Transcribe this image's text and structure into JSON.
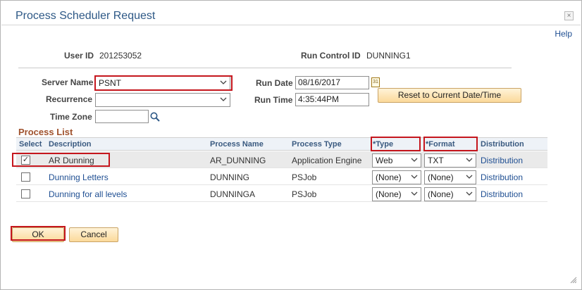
{
  "dialog": {
    "title": "Process Scheduler Request",
    "close_label": "×",
    "help_label": "Help"
  },
  "header": {
    "user_id_label": "User ID",
    "user_id_value": "201253052",
    "run_control_label": "Run Control ID",
    "run_control_value": "DUNNING1"
  },
  "form": {
    "server_name_label": "Server Name",
    "server_name_value": "PSNT",
    "recurrence_label": "Recurrence",
    "recurrence_value": "",
    "time_zone_label": "Time Zone",
    "time_zone_value": "",
    "run_date_label": "Run Date",
    "run_date_value": "08/16/2017",
    "run_time_label": "Run Time",
    "run_time_value": "4:35:44PM",
    "reset_button_label": "Reset to Current Date/Time",
    "calendar_icon_text": "31"
  },
  "process_list": {
    "title": "Process List",
    "columns": [
      "Select",
      "Description",
      "Process Name",
      "Process Type",
      "*Type",
      "*Format",
      "Distribution"
    ],
    "rows": [
      {
        "selected": true,
        "description": "AR Dunning",
        "process_name": "AR_DUNNING",
        "process_type": "Application Engine",
        "type": "Web",
        "format": "TXT",
        "distribution": "Distribution",
        "check": "✓"
      },
      {
        "selected": false,
        "description": "Dunning Letters",
        "process_name": "DUNNING",
        "process_type": "PSJob",
        "type": "(None)",
        "format": "(None)",
        "distribution": "Distribution",
        "check": ""
      },
      {
        "selected": false,
        "description": "Dunning for all levels",
        "process_name": "DUNNINGA",
        "process_type": "PSJob",
        "type": "(None)",
        "format": "(None)",
        "distribution": "Distribution",
        "check": ""
      }
    ]
  },
  "footer": {
    "ok_label": "OK",
    "cancel_label": "Cancel"
  },
  "colors": {
    "highlight_red": "#c5161d",
    "title_blue": "#2d5886",
    "link_blue": "#1e4e92",
    "section_brown": "#a0522d"
  },
  "icons": [
    "close-icon",
    "calendar-icon",
    "search-icon",
    "chevron-down-icon",
    "checkmark-icon",
    "resize-grip-icon"
  ]
}
